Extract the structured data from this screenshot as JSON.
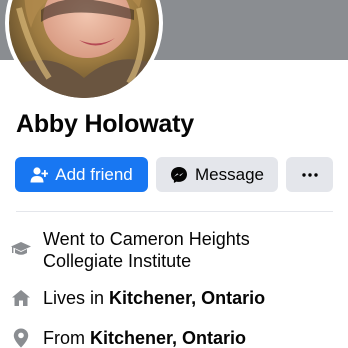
{
  "profile": {
    "name": "Abby Holowaty"
  },
  "actions": {
    "add_friend": "Add friend",
    "message": "Message",
    "more": "···"
  },
  "intro": {
    "education": {
      "line1": "Went to Cameron Heights",
      "line2": "Collegiate Institute"
    },
    "lives": {
      "prefix": "Lives in ",
      "place": "Kitchener, Ontario"
    },
    "from": {
      "prefix": "From ",
      "place": "Kitchener, Ontario"
    }
  },
  "icons": {
    "add_friend": "add-friend-icon",
    "message": "messenger-icon",
    "more": "more-dots-icon",
    "education": "graduation-cap-icon",
    "lives": "home-icon",
    "from": "location-pin-icon"
  },
  "colors": {
    "primary": "#1877f2",
    "secondary_button": "#e4e6eb",
    "icon_gray": "#8a8d91",
    "cover": "#8a8d91",
    "text": "#050505"
  }
}
